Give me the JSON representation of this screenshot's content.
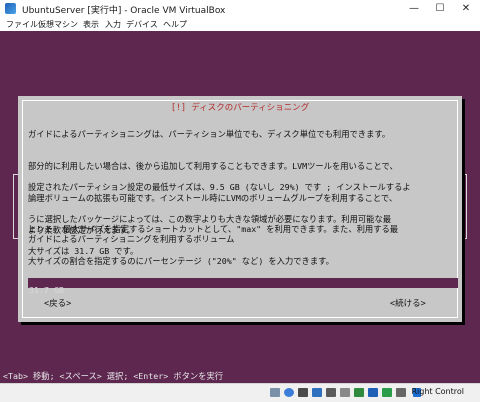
{
  "window": {
    "title": "UbuntuServer [実行中] - Oracle VM VirtualBox",
    "minimize": "—",
    "maximize": "☐",
    "close": "✕"
  },
  "menu": [
    "ファイル",
    "仮想マシン",
    "表示",
    "入力",
    "デバイス",
    "ヘルプ"
  ],
  "dialog": {
    "title": "[!] ディスクのパーティショニング",
    "para1": [
      "ガイドによるパーティショニングは、パーティション単位でも、ディスク単位でも利用できます。",
      "部分的に利用したい場合は、後から追加して利用することもできます。LVMツールを用いることで、",
      "論理ボリュームの拡張も可能です。インストール時にLVMのボリュームグループを利用することで、",
      "より柔軟な設定が行えます。"
    ],
    "para2": [
      "設定されたパーティション設定の最低サイズは、9.5 GB (ないし 29%) です ; インストールするよ",
      "うに選択したパッケージによっては、この数字よりも大きな領域が必要になります。利用可能な最",
      "大サイズは 31.7 GB です。"
    ],
    "para3": [
      "ヒント: 最大サイズを指定するショートカットとして、\"max\" を利用できます。また、利用する最",
      "大サイズの割合を指定するのにパーセンテージ (\"20%\" など) を入力できます。"
    ],
    "prompt": "ガイドによるパーティショニングを利用するボリューム",
    "input_value": "31.7 GB",
    "back_button": "<戻る>",
    "continue_button": "<続ける>"
  },
  "hint": "<Tab> 移動; <スペース> 選択; <Enter> ボタンを実行",
  "status": {
    "host_key": "Right Control"
  },
  "colors": {
    "vm_background": "#5e2750",
    "dialog_background": "#c7c7c7",
    "title_accent": "#b42a2a"
  }
}
